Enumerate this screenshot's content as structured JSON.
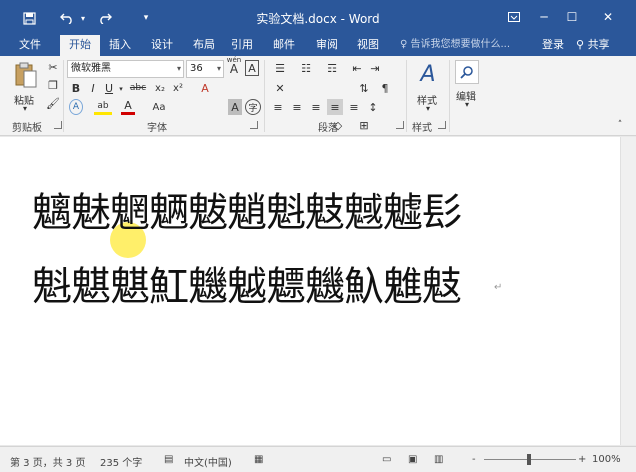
{
  "window": {
    "title": "实验文档.docx - Word",
    "save_icon": "save-icon",
    "undo_icon": "undo-icon",
    "redo_icon": "redo-icon",
    "qat_more": "▾",
    "restore_ribbon_icon": "ribbon-display-icon",
    "minimize": "─",
    "maximize": "☐",
    "close": "✕"
  },
  "tabs": [
    {
      "label": "文件",
      "active": false
    },
    {
      "label": "开始",
      "active": true
    },
    {
      "label": "插入",
      "active": false
    },
    {
      "label": "设计",
      "active": false
    },
    {
      "label": "布局",
      "active": false
    },
    {
      "label": "引用",
      "active": false
    },
    {
      "label": "邮件",
      "active": false
    },
    {
      "label": "审阅",
      "active": false
    },
    {
      "label": "视图",
      "active": false
    }
  ],
  "tell_me": "♀ 告诉我您想要做什么...",
  "login": "登录",
  "share": "共享",
  "ribbon": {
    "clipboard": {
      "paste_label": "粘贴",
      "group_label": "剪贴板"
    },
    "font": {
      "font_name": "微软雅黑",
      "font_size": "36",
      "grow": "A",
      "shrink": "A",
      "change_case": "Aa",
      "clear_format": "A",
      "wen": "wén",
      "char_border": "A",
      "bold": "B",
      "italic": "I",
      "underline": "U",
      "strike": "abc",
      "subscript": "x₂",
      "superscript": "x²",
      "text_effect": "A",
      "highlight": "ab",
      "font_color": "A",
      "size_case": "Aa",
      "char_shade": "A",
      "enclose": "字",
      "group_label": "字体"
    },
    "paragraph": {
      "group_label": "段落"
    },
    "styles": {
      "label": "样式",
      "group_label": "样式"
    },
    "editing": {
      "label": "编辑"
    }
  },
  "document": {
    "line1": "魑魅魍魉魃魈魁鬾魊魖髟",
    "line2": "魁魌魌魟魕魆魒魕魞魋鬾",
    "paragraph_mark": "↵"
  },
  "status": {
    "page": "第 3 页，共 3 页",
    "words": "235 个字",
    "language": "中文(中国)",
    "zoom": "100%",
    "zoom_minus": "-",
    "zoom_plus": "+"
  }
}
